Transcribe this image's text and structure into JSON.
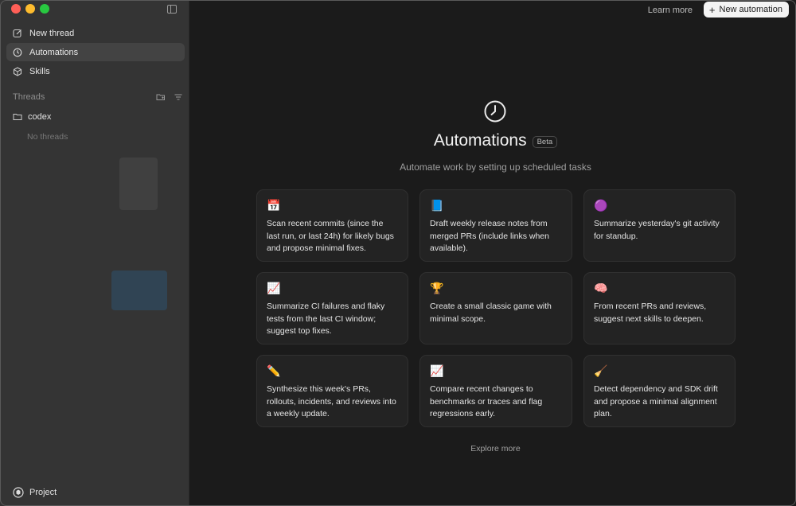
{
  "sidebar": {
    "nav": [
      {
        "label": "New thread",
        "icon": "edit-icon"
      },
      {
        "label": "Automations",
        "icon": "clock-icon",
        "active": true
      },
      {
        "label": "Skills",
        "icon": "cube-icon"
      }
    ],
    "threads_label": "Threads",
    "folder_label": "codex",
    "empty_label": "No threads",
    "project_label": "Project"
  },
  "header": {
    "learn_more": "Learn more",
    "new_automation": "New automation"
  },
  "main": {
    "title": "Automations",
    "badge": "Beta",
    "subtitle": "Automate work by setting up scheduled tasks",
    "cards": [
      {
        "emoji": "📅",
        "text": "Scan recent commits (since the last run, or last 24h) for likely bugs and propose minimal fixes."
      },
      {
        "emoji": "📘",
        "text": "Draft weekly release notes from merged PRs (include links when available)."
      },
      {
        "emoji": "🟣",
        "text": "Summarize yesterday's git activity for standup."
      },
      {
        "emoji": "📈",
        "text": "Summarize CI failures and flaky tests from the last CI window; suggest top fixes."
      },
      {
        "emoji": "🏆",
        "text": "Create a small classic game with minimal scope."
      },
      {
        "emoji": "🧠",
        "text": "From recent PRs and reviews, suggest next skills to deepen."
      },
      {
        "emoji": "✏️",
        "text": "Synthesize this week's PRs, rollouts, incidents, and reviews into a weekly update."
      },
      {
        "emoji": "📈",
        "text": "Compare recent changes to benchmarks or traces and flag regressions early."
      },
      {
        "emoji": "🧹",
        "text": "Detect dependency and SDK drift and propose a minimal alignment plan."
      }
    ],
    "explore_more": "Explore more"
  }
}
